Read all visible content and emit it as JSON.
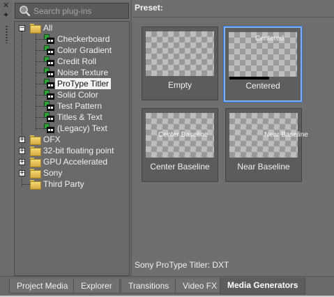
{
  "search": {
    "placeholder": "Search plug-ins",
    "value": ""
  },
  "tree": {
    "root": "All",
    "plugins": [
      "Checkerboard",
      "Color Gradient",
      "Credit Roll",
      "Noise Texture",
      "ProType Titler",
      "Solid Color",
      "Test Pattern",
      "Titles & Text",
      "(Legacy) Text"
    ],
    "selected_plugin": "ProType Titler",
    "groups": [
      "OFX",
      "32-bit floating point",
      "GPU Accelerated",
      "Sony",
      "Third Party"
    ]
  },
  "preset": {
    "label": "Preset:",
    "tiles": [
      {
        "name": "Empty",
        "overlay": ""
      },
      {
        "name": "Centered",
        "overlay": "Centered"
      },
      {
        "name": "Center Baseline",
        "overlay": "Center Baseline"
      },
      {
        "name": "Near Baseline",
        "overlay": "Near Baseline"
      }
    ],
    "selected_tile": "Centered"
  },
  "status": {
    "text": "Sony ProType Titler: DXT"
  },
  "tabs": [
    "Project Media",
    "Explorer",
    "Transitions",
    "Video FX",
    "Media Generators"
  ],
  "active_tab": "Media Generators",
  "colors": {
    "selection_border": "#7fb0ff",
    "panel_bg": "#6f6f6f"
  },
  "icons": {
    "close": "close-icon",
    "pin": "pin-icon",
    "search": "search-icon",
    "folder": "folder-icon",
    "plugin": "plugin-icon"
  }
}
